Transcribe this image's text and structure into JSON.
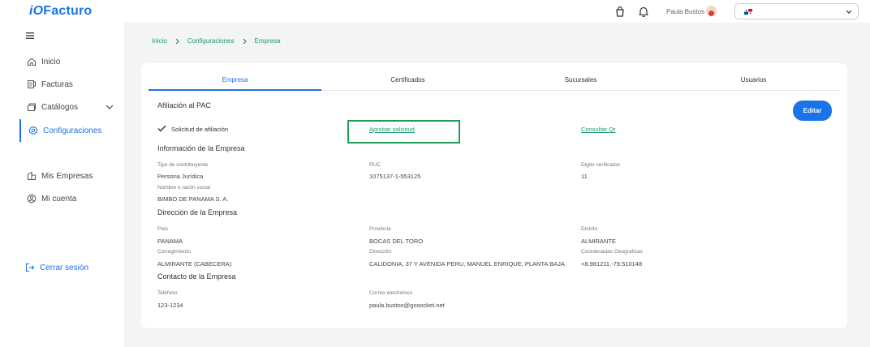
{
  "app": {
    "logo_prefix": "iO",
    "logo_name": "Facturo"
  },
  "header": {
    "user_name": "Paula Bustos",
    "language_value": ""
  },
  "sidebar": {
    "items": [
      {
        "label": "Inicio"
      },
      {
        "label": "Facturas"
      },
      {
        "label": "Catálogos"
      },
      {
        "label": "Configuraciones"
      },
      {
        "label": "Mis Empresas"
      },
      {
        "label": "Mi cuenta"
      }
    ],
    "logout": "Cerrar sesión"
  },
  "breadcrumb": [
    "Inicio",
    "Configuraciones",
    "Empresa"
  ],
  "tabs": [
    "Empresa",
    "Certificados",
    "Sucursales",
    "Usuarios"
  ],
  "pac": {
    "title": "Afiliación al PAC",
    "request_label": "Solicitud de afiliación",
    "approve_link": "Aprobar solicitud",
    "qr_link": "Consultar Qr",
    "edit_button": "Editar"
  },
  "company": {
    "title": "Información de la Empresa",
    "taxpayer_type_label": "Tipo de contribuyente",
    "taxpayer_type": "Persona Jurídica",
    "ruc_label": "RUC",
    "ruc": "1075137-1-553125",
    "dv_label": "Digito verificador",
    "dv": "11",
    "name_label": "Nombre o razón social",
    "name": "BIMBO DE PANAMA S. A."
  },
  "address": {
    "title": "Dirección de la Empresa",
    "country_label": "País",
    "country": "PANAMA",
    "province_label": "Provincia",
    "province": "BOCAS DEL TORO",
    "district_label": "Distrito",
    "district": "ALMIRANTE",
    "corregimiento_label": "Corregimiento",
    "corregimiento": "ALMIRANTE (CABECERA)",
    "address_label": "Dirección",
    "address": "CALIDONIA, 37 Y AVENIDA PERU, MANUEL ENRIQUE, PLANTA BAJA",
    "coords_label": "Coordenadas Geograficas",
    "coords": "+8.981211,-79.510148"
  },
  "contact": {
    "title": "Contacto de la Empresa",
    "phone_label": "Teléfono",
    "phone": "123-1234",
    "email_label": "Correo electrónico",
    "email": "paula.bustos@gosocket.net"
  },
  "colors": {
    "primary": "#1a73e8",
    "link": "#1a9c6b",
    "highlight": "#1e9b57"
  }
}
